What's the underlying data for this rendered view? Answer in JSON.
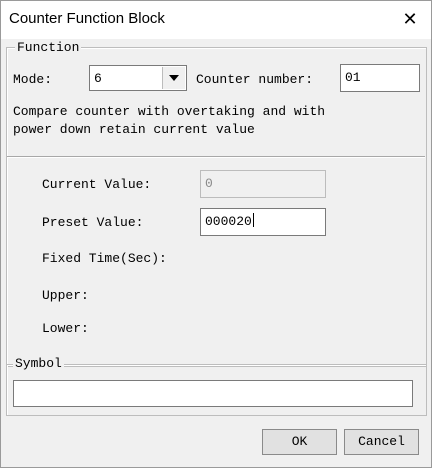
{
  "window": {
    "title": "Counter Function Block",
    "close_glyph": "✕"
  },
  "function_group": {
    "legend": "Function",
    "mode_label": "Mode:",
    "mode_value": "6",
    "counter_number_label": "Counter number:",
    "counter_number_value": "01",
    "description_line1": "Compare counter with overtaking and with",
    "description_line2": "power down retain current value"
  },
  "values": {
    "current_value_label": "Current Value:",
    "current_value": "0",
    "preset_value_label": "Preset Value:",
    "preset_value": "000020",
    "fixed_time_label": "Fixed Time(Sec):",
    "upper_label": "Upper:",
    "lower_label": "Lower:"
  },
  "symbol_group": {
    "legend": "Symbol",
    "value": ""
  },
  "buttons": {
    "ok": "OK",
    "cancel": "Cancel"
  },
  "icons": {
    "close": "close-icon",
    "dropdown": "chevron-down-icon"
  }
}
